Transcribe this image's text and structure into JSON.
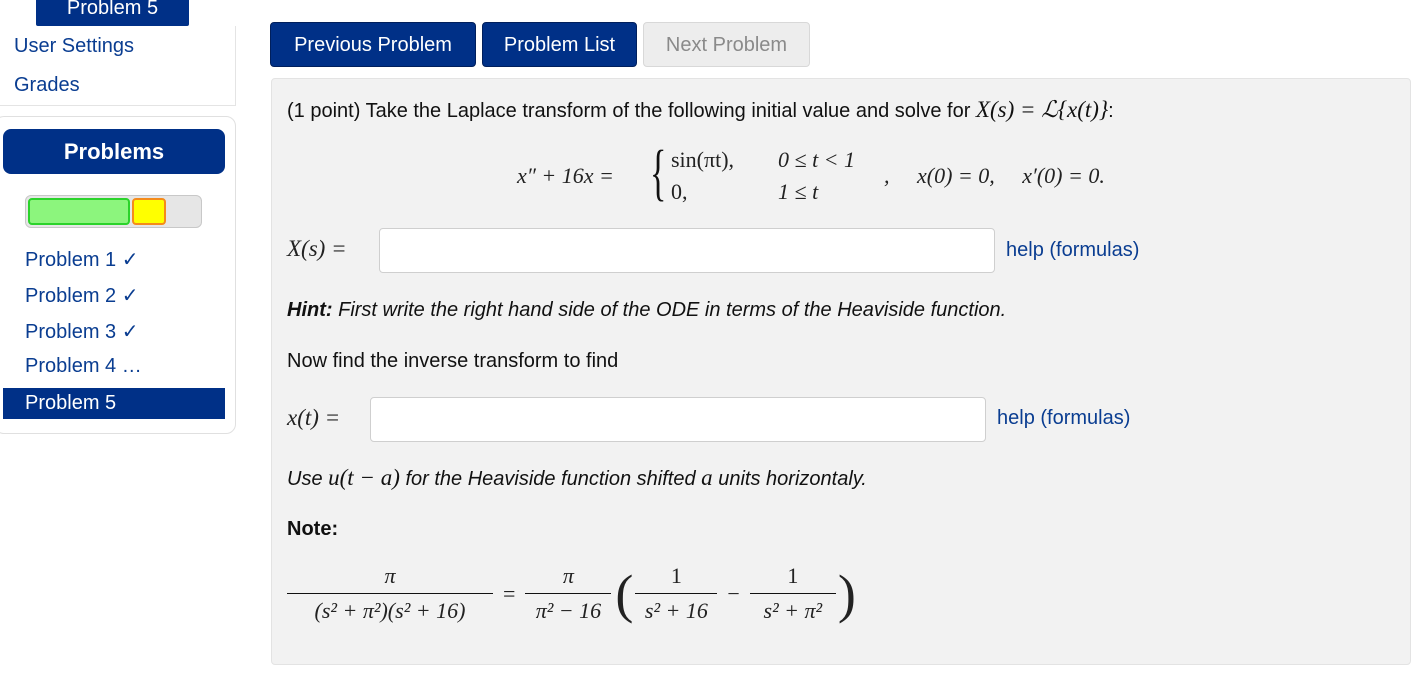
{
  "sidebar": {
    "top_tab_label": "Problem 5",
    "links": {
      "user_settings": "User Settings",
      "grades": "Grades"
    },
    "problems_header": "Problems",
    "progress": {
      "correct_fraction": 0.58,
      "partial_fraction": 0.19,
      "colors": {
        "correct": "#8cf57d",
        "partial": "#ffff00"
      }
    },
    "items": [
      {
        "label": "Problem 1 ✓"
      },
      {
        "label": "Problem 2 ✓"
      },
      {
        "label": "Problem 3 ✓"
      },
      {
        "label": "Problem 4 …"
      },
      {
        "label": "Problem 5"
      }
    ]
  },
  "nav_buttons": {
    "previous": "Previous Problem",
    "list": "Problem List",
    "next": "Next Problem"
  },
  "problem": {
    "intro": "(1 point) Take the Laplace transform of the following initial value and solve for",
    "intro_math": "X(s) = ℒ{x(t)}",
    "intro_colon": ":",
    "equation": {
      "lhs": "x″ + 16x =",
      "case1_expr": "sin(πt),",
      "case1_cond": "0 ≤ t < 1",
      "case2_expr": "0,",
      "case2_cond": "1 ≤ t",
      "ic": ",     x(0) = 0,     x′(0) = 0."
    },
    "answer1": {
      "label": "X(s) =",
      "value": "",
      "help": "help (formulas)"
    },
    "hint_label": "Hint:",
    "hint_text": "First write the right hand side of the ODE in terms of the Heaviside function.",
    "inverse_text": "Now find the inverse transform to find",
    "answer2": {
      "label": "x(t) =",
      "value": "",
      "help": "help (formulas)"
    },
    "use_text_1": "Use",
    "use_math": "u(t − a)",
    "use_text_2": "for the Heaviside function shifted",
    "use_math_a": "a",
    "use_text_3": "units horizontaly.",
    "note_label": "Note:",
    "note_eq": {
      "f1_num": "π",
      "f1_den": "(s² + π²)(s² + 16)",
      "eq": "=",
      "f2_num": "π",
      "f2_den": "π² − 16",
      "f3_num": "1",
      "f3_den": "s² + 16",
      "minus": "−",
      "f4_num": "1",
      "f4_den": "s² + π²"
    }
  }
}
